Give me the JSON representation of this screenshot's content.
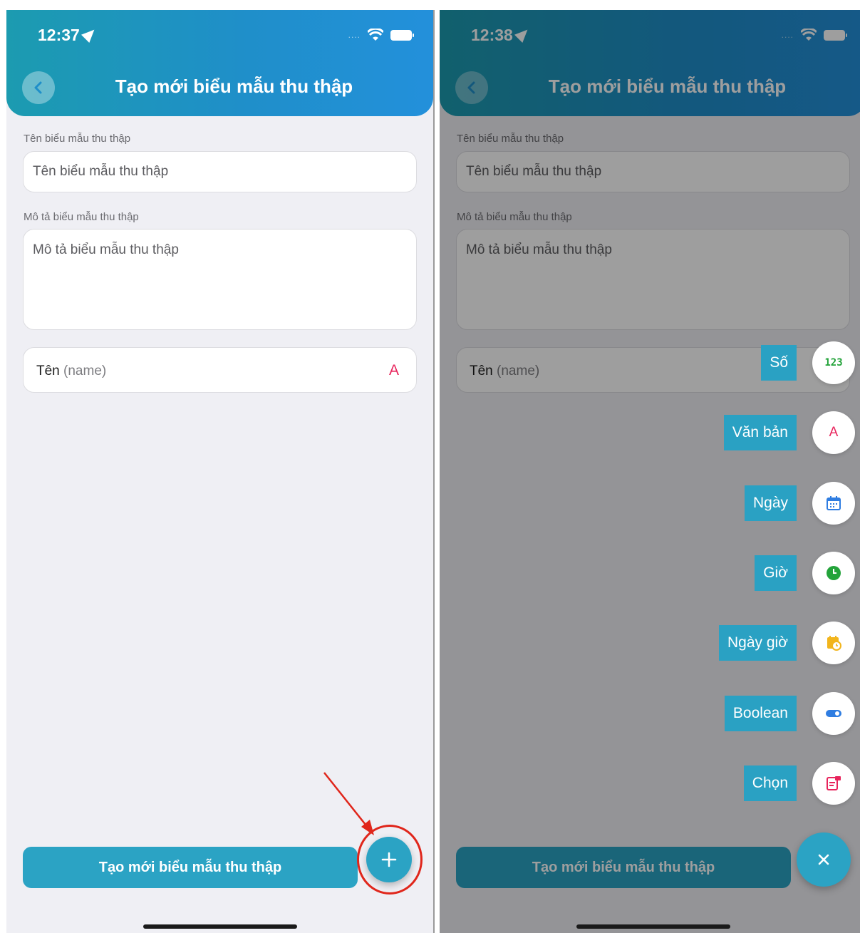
{
  "left": {
    "status_time": "12:37",
    "header_title": "Tạo mới biểu mẫu thu thập",
    "form_name_label": "Tên biểu mẫu thu thập",
    "form_name_placeholder": "Tên biểu mẫu thu thập",
    "form_desc_label": "Mô tả biểu mẫu thu thập",
    "form_desc_placeholder": "Mô tả biểu mẫu thu thập",
    "field_name": "Tên",
    "field_key": "(name)",
    "field_type_icon": "A",
    "submit_label": "Tạo mới biểu mẫu thu thập"
  },
  "right": {
    "status_time": "12:38",
    "header_title": "Tạo mới biểu mẫu thu thập",
    "form_name_label": "Tên biểu mẫu thu thập",
    "form_name_placeholder": "Tên biểu mẫu thu thập",
    "form_desc_label": "Mô tả biểu mẫu thu thập",
    "form_desc_placeholder": "Mô tả biểu mẫu thu thập",
    "field_name": "Tên",
    "field_key": "(name)",
    "submit_label": "Tạo mới biểu mẫu thu thập",
    "menu": [
      {
        "label": "Số",
        "icon": "number-icon",
        "icon_text": "123",
        "color": "#23a33a"
      },
      {
        "label": "Văn bản",
        "icon": "text-icon",
        "icon_text": "A",
        "color": "#e8245c"
      },
      {
        "label": "Ngày",
        "icon": "calendar-icon",
        "color": "#2f7de1"
      },
      {
        "label": "Giờ",
        "icon": "clock-icon",
        "color": "#23a33a"
      },
      {
        "label": "Ngày giờ",
        "icon": "calendar-clock-icon",
        "color": "#f2b51c"
      },
      {
        "label": "Boolean",
        "icon": "toggle-icon",
        "color": "#2f7de1"
      },
      {
        "label": "Chọn",
        "icon": "select-icon",
        "color": "#e8245c"
      }
    ]
  },
  "colors": {
    "accent": "#2ba3c4",
    "header_start": "#1c9bb0",
    "header_end": "#2390db",
    "annotation": "#e0261b"
  }
}
